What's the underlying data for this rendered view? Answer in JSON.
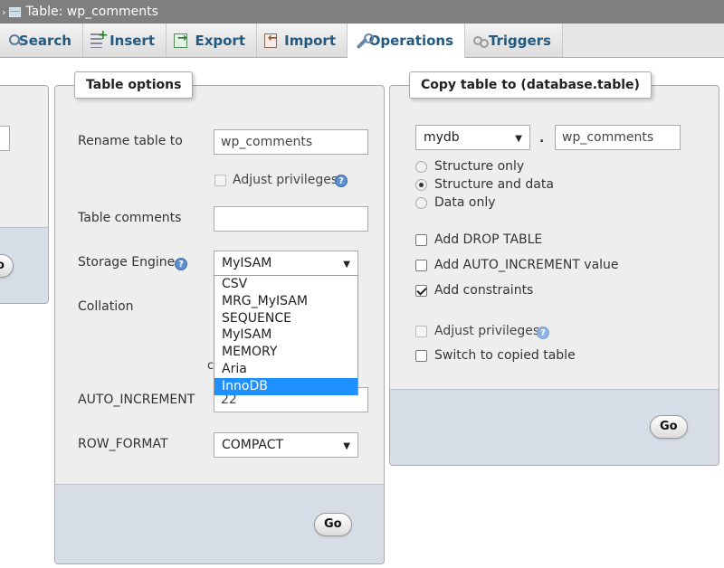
{
  "window": {
    "title": "Table: wp_comments"
  },
  "tabs": [
    {
      "label": "Search",
      "icon": "search-icon"
    },
    {
      "label": "Insert",
      "icon": "insert-icon"
    },
    {
      "label": "Export",
      "icon": "export-icon"
    },
    {
      "label": "Import",
      "icon": "import-icon"
    },
    {
      "label": "Operations",
      "icon": "wrench-icon",
      "active": true
    },
    {
      "label": "Triggers",
      "icon": "triggers-icon"
    }
  ],
  "table_options": {
    "legend": "Table options",
    "rename_label": "Rename table to",
    "rename_value": "wp_comments",
    "adjust_privileges_label": "Adjust privileges",
    "comments_label": "Table comments",
    "comments_value": "",
    "engine_label": "Storage Engine",
    "engine_value": "MyISAM",
    "engine_options": [
      "CSV",
      "MRG_MyISAM",
      "SEQUENCE",
      "MyISAM",
      "MEMORY",
      "Aria",
      "InnoDB"
    ],
    "engine_highlighted": "InnoDB",
    "collation_label": "Collation",
    "collation_partial": "c",
    "auto_increment_label": "AUTO_INCREMENT",
    "auto_increment_value": "22",
    "row_format_label": "ROW_FORMAT",
    "row_format_value": "COMPACT",
    "go_label": "Go"
  },
  "copy_table": {
    "legend": "Copy table to (database.table)",
    "database_value": "mydb",
    "separator": ".",
    "table_value": "wp_comments",
    "radio_options": [
      {
        "label": "Structure only",
        "checked": false
      },
      {
        "label": "Structure and data",
        "checked": true
      },
      {
        "label": "Data only",
        "checked": false
      }
    ],
    "add_drop_table_label": "Add DROP TABLE",
    "add_auto_increment_label": "Add AUTO_INCREMENT value",
    "add_constraints_label": "Add constraints",
    "adjust_privileges_label": "Adjust privileges",
    "switch_label": "Switch to copied table",
    "go_label": "Go"
  },
  "left_panel": {
    "go_label_partial": "o"
  },
  "colors": {
    "accent": "#235a81",
    "selected": "#1e90ff",
    "footer": "#d6dde6"
  }
}
